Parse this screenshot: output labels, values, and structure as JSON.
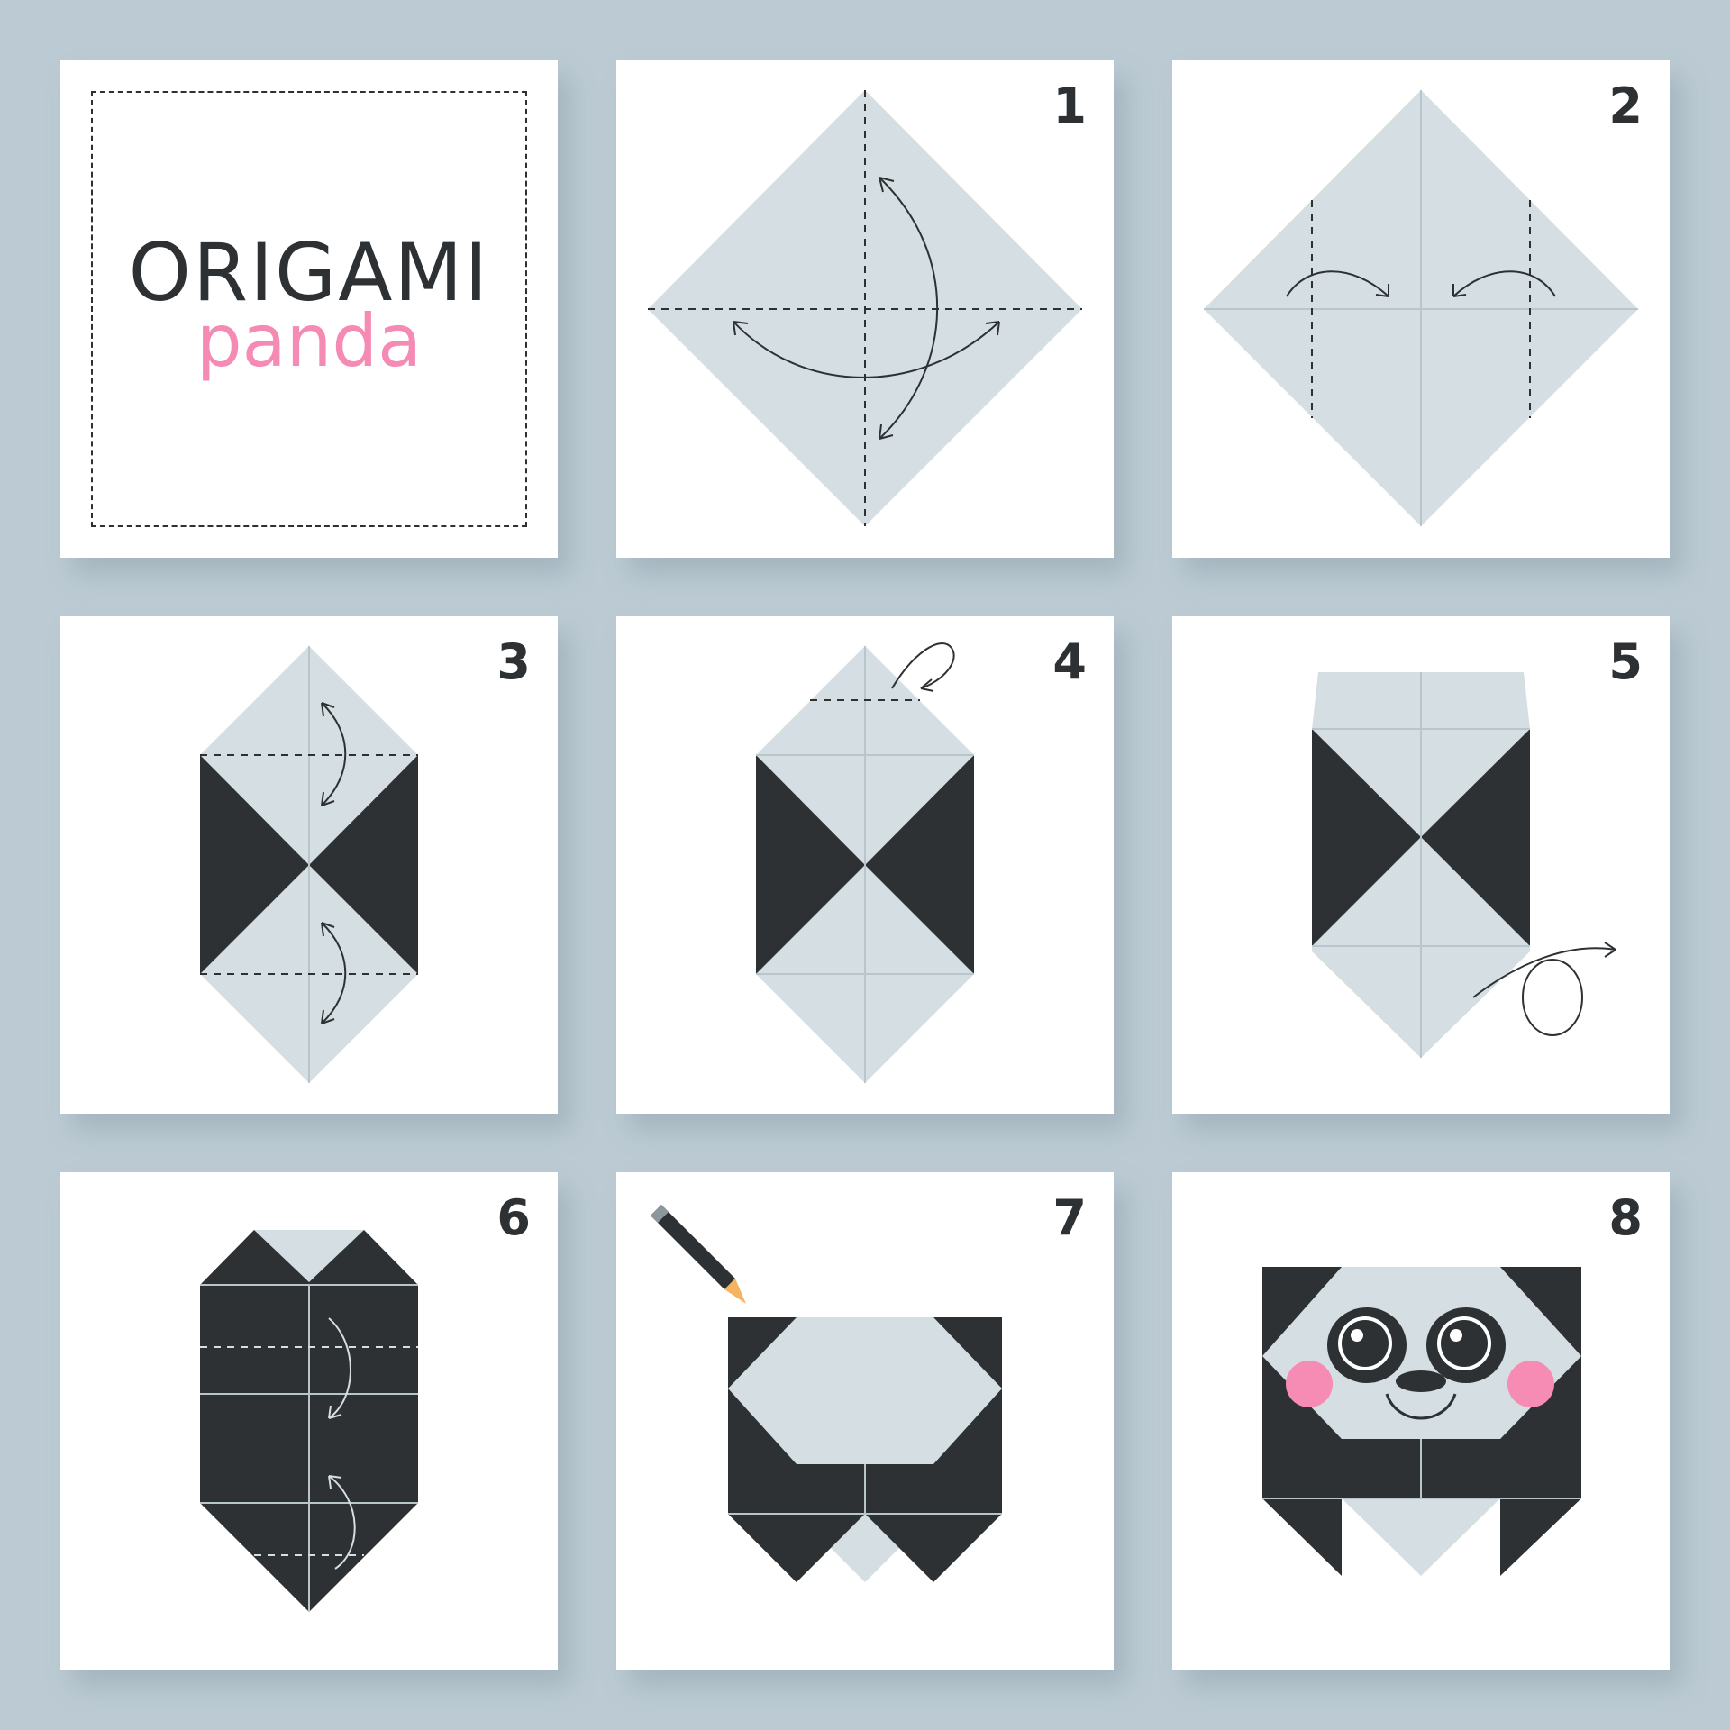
{
  "title": {
    "main": "ORIGAMI",
    "sub": "panda"
  },
  "steps": [
    {
      "number": "1"
    },
    {
      "number": "2"
    },
    {
      "number": "3"
    },
    {
      "number": "4"
    },
    {
      "number": "5"
    },
    {
      "number": "6"
    },
    {
      "number": "7"
    },
    {
      "number": "8"
    }
  ],
  "colors": {
    "background": "#bccbd3",
    "card": "#ffffff",
    "paper_light": "#d5dee3",
    "paper_dark": "#2d3133",
    "accent_pink": "#f58ab4",
    "cheek_pink": "#f68cb4",
    "line": "#2d3133"
  },
  "icons": [
    "pencil-icon",
    "fold-arrow-icon",
    "turn-over-icon"
  ]
}
